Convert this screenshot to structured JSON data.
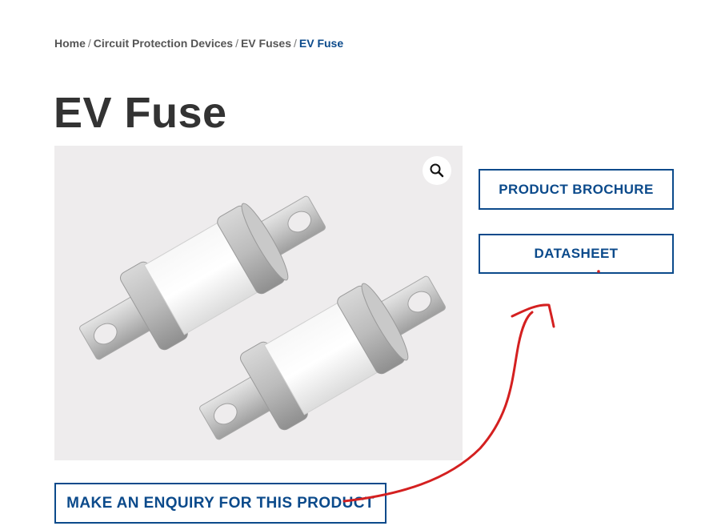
{
  "breadcrumb": {
    "items": [
      {
        "label": "Home"
      },
      {
        "label": "Circuit Protection Devices"
      },
      {
        "label": "EV Fuses"
      }
    ],
    "separator": "/",
    "current": "EV Fuse"
  },
  "product": {
    "title": "EV Fuse",
    "zoom_icon": "magnifier-icon"
  },
  "buttons": {
    "brochure": "PRODUCT BROCHURE",
    "datasheet": "DATASHEET",
    "enquiry": "MAKE AN ENQUIRY FOR THIS PRODUCT"
  },
  "colors": {
    "brand_blue": "#0b4a8b",
    "title_gray": "#333333",
    "annotation_red": "#d42020"
  }
}
